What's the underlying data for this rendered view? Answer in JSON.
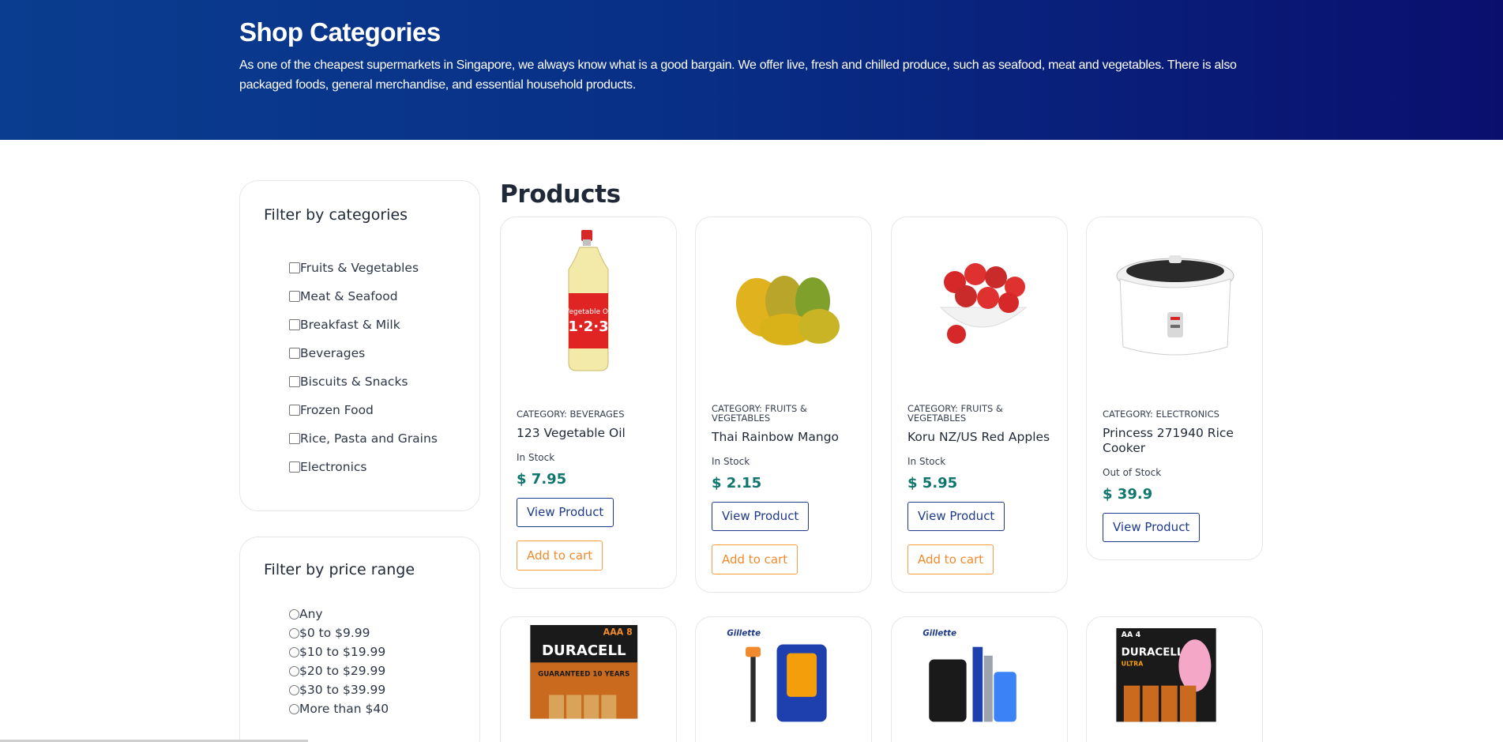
{
  "hero": {
    "title": "Shop Categories",
    "description": "As one of the cheapest supermarkets in Singapore, we always know what is a good bargain. We offer live, fresh and chilled produce, such as seafood, meat and vegetables. There is also packaged foods, general merchandise, and essential household products."
  },
  "category_filter": {
    "title": "Filter by categories",
    "options": [
      "Fruits & Vegetables",
      "Meat & Seafood",
      "Breakfast & Milk",
      "Beverages",
      "Biscuits & Snacks",
      "Frozen Food",
      "Rice, Pasta and Grains",
      "Electronics"
    ]
  },
  "price_filter": {
    "title": "Filter by price range",
    "options": [
      "Any",
      "$0 to $9.99",
      "$10 to $19.99",
      "$20 to $29.99",
      "$30 to $39.99",
      "More than $40"
    ]
  },
  "products": {
    "title": "Products",
    "view_label": "View Product",
    "cart_label": "Add to cart",
    "items": [
      {
        "category": "CATEGORY: BEVERAGES",
        "name": "123 Vegetable Oil",
        "stock": "In Stock",
        "price": "$ 7.95",
        "image": "oil-bottle"
      },
      {
        "category": "CATEGORY: FRUITS & VEGETABLES",
        "name": "Thai Rainbow Mango",
        "stock": "In Stock",
        "price": "$ 2.15",
        "image": "mangoes"
      },
      {
        "category": "CATEGORY: FRUITS & VEGETABLES",
        "name": "Koru NZ/US Red Apples",
        "stock": "In Stock",
        "price": "$ 5.95",
        "image": "apple-bowl"
      },
      {
        "category": "CATEGORY: ELECTRONICS",
        "name": "Princess 271940 Rice Cooker",
        "stock": "Out of Stock",
        "price": "$ 39.9",
        "image": "rice-cooker"
      }
    ],
    "second_row": [
      {
        "image": "duracell-aaa-pack",
        "brand_text": "DURACELL",
        "pack_text": "AAA 8",
        "tag_text": "GUARANTEED 10 YEARS"
      },
      {
        "image": "gillette-razor-pack",
        "brand_text": "Gillette"
      },
      {
        "image": "gillette-styler-pack",
        "brand_text": "Gillette"
      },
      {
        "image": "duracell-ultra-aa-pack",
        "brand_text": "DURACELL",
        "pack_text": "AA 4",
        "tag_text": "ULTRA"
      }
    ]
  },
  "colors": {
    "hero_start": "#0a3d8f",
    "hero_end": "#0a0f6e",
    "price": "#0f766e",
    "view_button": "#1e3a8a",
    "cart_button": "#f08a2c"
  }
}
